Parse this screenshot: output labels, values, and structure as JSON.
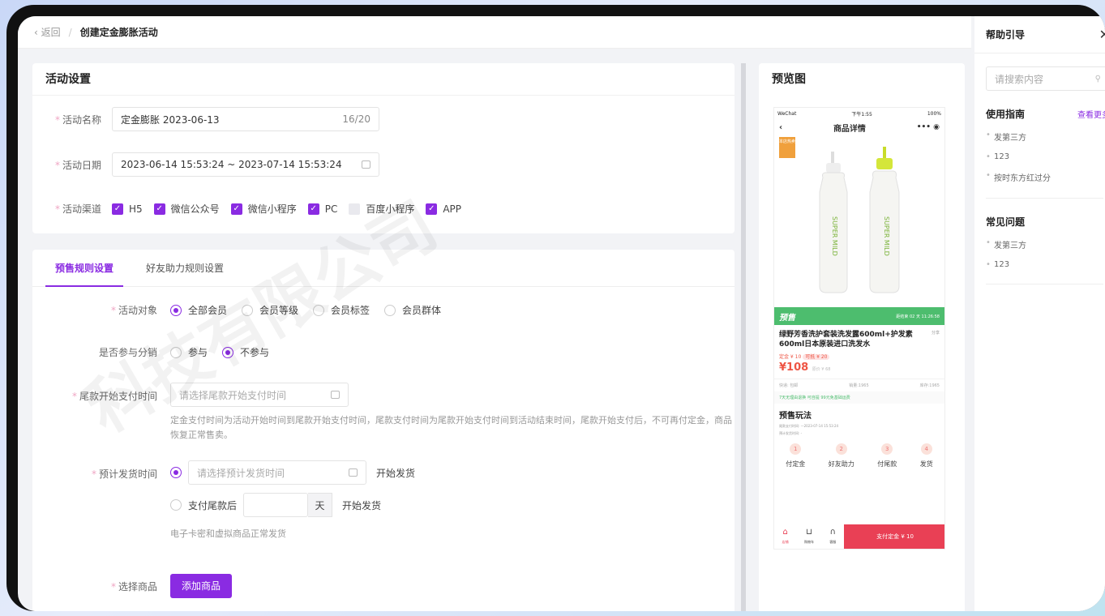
{
  "breadcrumb": {
    "back": "返回",
    "separator": "/",
    "current": "创建定金膨胀活动"
  },
  "activity_settings": {
    "title": "活动设置",
    "name_label": "活动名称",
    "name_value": "定金膨胀  2023-06-13",
    "name_count": "16/20",
    "date_label": "活动日期",
    "date_value": "2023-06-14 15:53:24 ~ 2023-07-14 15:53:24",
    "channel_label": "活动渠道",
    "channels": [
      {
        "label": "H5",
        "checked": true
      },
      {
        "label": "微信公众号",
        "checked": true
      },
      {
        "label": "微信小程序",
        "checked": true
      },
      {
        "label": "PC",
        "checked": true
      },
      {
        "label": "百度小程序",
        "checked": false
      },
      {
        "label": "APP",
        "checked": true
      }
    ]
  },
  "rules": {
    "tabs": [
      "预售规则设置",
      "好友助力规则设置"
    ],
    "target_label": "活动对象",
    "targets": [
      "全部会员",
      "会员等级",
      "会员标签",
      "会员群体"
    ],
    "distribution_label": "是否参与分销",
    "distribution_options": [
      "参与",
      "不参与"
    ],
    "balance_label": "尾款开始支付时间",
    "balance_placeholder": "请选择尾款开始支付时间",
    "balance_hint": "定金支付时间为活动开始时间到尾款开始支付时间，尾款支付时间为尾款开始支付时间到活动结束时间，尾款开始支付后，不可再付定金，商品恢复正常售卖。",
    "ship_label": "预计发货时间",
    "ship_placeholder": "请选择预计发货时间",
    "ship_suffix": "开始发货",
    "ship_after_label": "支付尾款后",
    "ship_unit": "天",
    "ship_after_suffix": "开始发货",
    "ship_hint": "电子卡密和虚拟商品正常发货",
    "goods_label": "选择商品",
    "add_goods": "添加商品"
  },
  "preview": {
    "title": "预览图",
    "status_left": "WeChat",
    "status_time": "下午1:55",
    "status_right": "100%",
    "nav_title": "商品详情",
    "tag": "本店热卖",
    "bottle_text": "SUPER MILD",
    "presale_label": "预售",
    "presale_countdown": "距结束 02 天 11:26:58",
    "product_name": "绿野芳香洗护套装洗发露600ml+护发素600ml日本原装进口洗发水",
    "share": "分享",
    "deposit": "定金 ¥ 10",
    "deposit_tag": "可抵 ¥ 20",
    "price": "¥108",
    "orig_price": "原价 ¥ 68",
    "shipping": "快递: 包邮",
    "sales": "销量:1965",
    "stock": "库存:1965",
    "guarantee": "7天无理由退换   可自提   99元免基础运费",
    "play_title": "预售玩法",
    "play_sub1": "尾款支付时间: —2023-07-14 15:53:24",
    "play_sub2": "预计发货时间: -",
    "steps": [
      {
        "n": "1",
        "t": "付定金"
      },
      {
        "n": "2",
        "t": "好友助力"
      },
      {
        "n": "3",
        "t": "付尾款"
      },
      {
        "n": "4",
        "t": "发货"
      }
    ],
    "tab_shop": "店铺",
    "tab_cart": "购物车",
    "tab_service": "客服",
    "pay_button": "支付定金 ¥ 10"
  },
  "help": {
    "title": "帮助引导",
    "search_placeholder": "请搜索内容",
    "guide_title": "使用指南",
    "guide_more": "查看更多",
    "guide_items": [
      "发第三方",
      "123",
      "按时东方红过分"
    ],
    "faq_title": "常见问题",
    "faq_items": [
      "发第三方",
      "123"
    ]
  },
  "colors": {
    "accent": "#8a2be2",
    "presale": "#4dbd6e",
    "pay": "#e94055"
  },
  "watermark": "科技有限公司"
}
